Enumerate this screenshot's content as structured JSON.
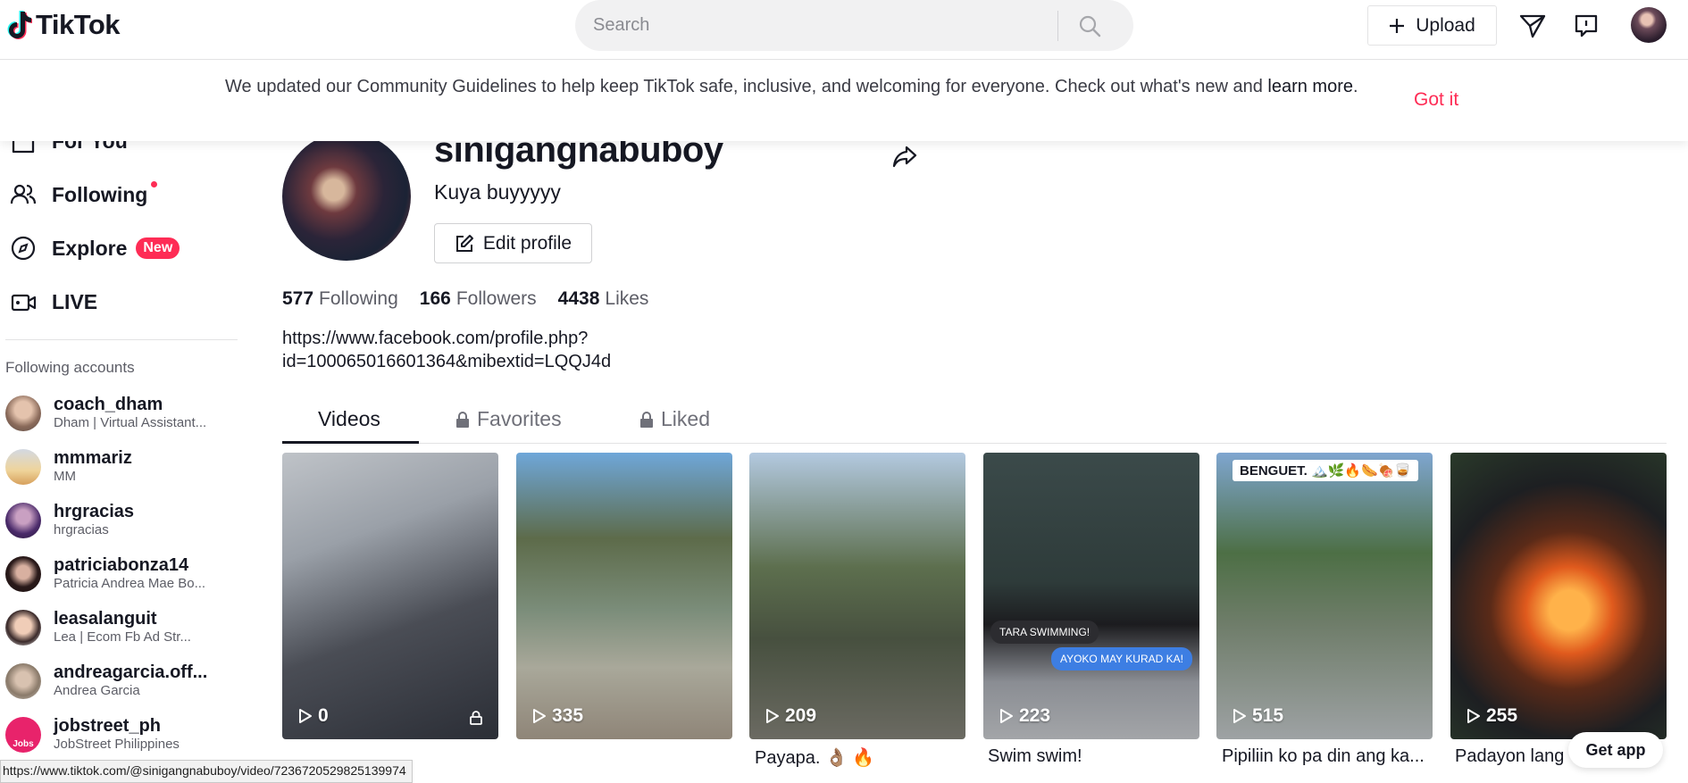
{
  "header": {
    "logo_text": "TikTok",
    "search_placeholder": "Search",
    "upload_label": "Upload"
  },
  "banner": {
    "text": "We updated our Community Guidelines to help keep TikTok safe, inclusive, and welcoming for everyone. Check out what's new and ",
    "link": "learn more",
    "suffix": ".",
    "dismiss": "Got it"
  },
  "sidebar": {
    "nav": [
      {
        "label": "For You",
        "icon": "home-icon"
      },
      {
        "label": "Following",
        "icon": "people-icon",
        "dot": true
      },
      {
        "label": "Explore",
        "icon": "compass-icon",
        "badge": "New"
      },
      {
        "label": "LIVE",
        "icon": "live-icon"
      }
    ],
    "following_heading": "Following accounts",
    "accounts": [
      {
        "name": "coach_dham",
        "sub": "Dham | Virtual Assistant...",
        "color": "#c9a58f"
      },
      {
        "name": "mmmariz",
        "sub": "MM",
        "color": "#e3c28a"
      },
      {
        "name": "hrgracias",
        "sub": "hrgracias",
        "color": "#5a3a7a"
      },
      {
        "name": "patriciabonza14",
        "sub": "Patricia Andrea Mae Bo...",
        "color": "#3a2a2a"
      },
      {
        "name": "leasalanguit",
        "sub": "Lea | Ecom Fb Ad Str...",
        "color": "#e8b9a6"
      },
      {
        "name": "andreagarcia.off...",
        "sub": "Andrea Garcia",
        "color": "#9a8a7a"
      },
      {
        "name": "jobstreet_ph",
        "sub": "JobStreet Philippines",
        "color": "#e8236b"
      }
    ]
  },
  "profile": {
    "username": "sinigangnabuboy",
    "nickname": "Kuya buyyyyy",
    "edit_label": "Edit profile",
    "stats": [
      {
        "num": "577",
        "label": "Following"
      },
      {
        "num": "166",
        "label": "Followers"
      },
      {
        "num": "4438",
        "label": "Likes"
      }
    ],
    "bio_line1": "https://www.facebook.com/profile.php?",
    "bio_line2": "id=100065016601364&mibextid=LQQJ4d"
  },
  "tabs": {
    "videos": "Videos",
    "favorites": "Favorites",
    "liked": "Liked"
  },
  "videos": [
    {
      "views": "0",
      "caption": "",
      "private": true
    },
    {
      "views": "335",
      "caption": ""
    },
    {
      "views": "209",
      "caption": "Payapa. 👌🏽 🔥"
    },
    {
      "views": "223",
      "caption": "Swim swim!",
      "bubble1": "TARA SWIMMING!",
      "bubble2": "AYOKO MAY KURAD KA!"
    },
    {
      "views": "515",
      "caption": "Pipiliin ko pa din ang ka...",
      "tag": "BENGUET. 🏔️🌿🔥🌭🍖🥃"
    },
    {
      "views": "255",
      "caption": "Padayon lang"
    }
  ],
  "get_app": "Get app",
  "status_url": "https://www.tiktok.com/@sinigangnabuboy/video/7236720529825139974",
  "colors": {
    "accent": "#fe2c55",
    "text": "#161823"
  }
}
